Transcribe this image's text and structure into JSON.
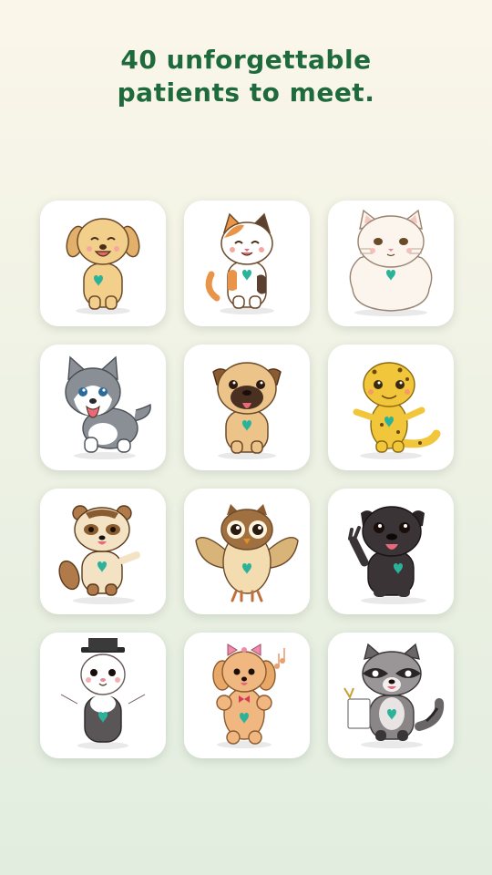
{
  "headline": {
    "line1": "40 unforgettable",
    "line2": "patients to meet."
  },
  "colors": {
    "headline": "#1f6a3c",
    "card_background": "#ffffff",
    "heart": "#2bb39a"
  },
  "patients": [
    {
      "icon": "golden-puppy-icon"
    },
    {
      "icon": "calico-kitten-icon"
    },
    {
      "icon": "fluffy-white-cat-icon"
    },
    {
      "icon": "husky-puppy-icon"
    },
    {
      "icon": "pug-icon"
    },
    {
      "icon": "leopard-gecko-icon"
    },
    {
      "icon": "raccoon-dog-icon"
    },
    {
      "icon": "owl-icon"
    },
    {
      "icon": "black-pug-icon"
    },
    {
      "icon": "ferret-top-hat-icon"
    },
    {
      "icon": "poodle-icon"
    },
    {
      "icon": "raccoon-icon"
    }
  ]
}
